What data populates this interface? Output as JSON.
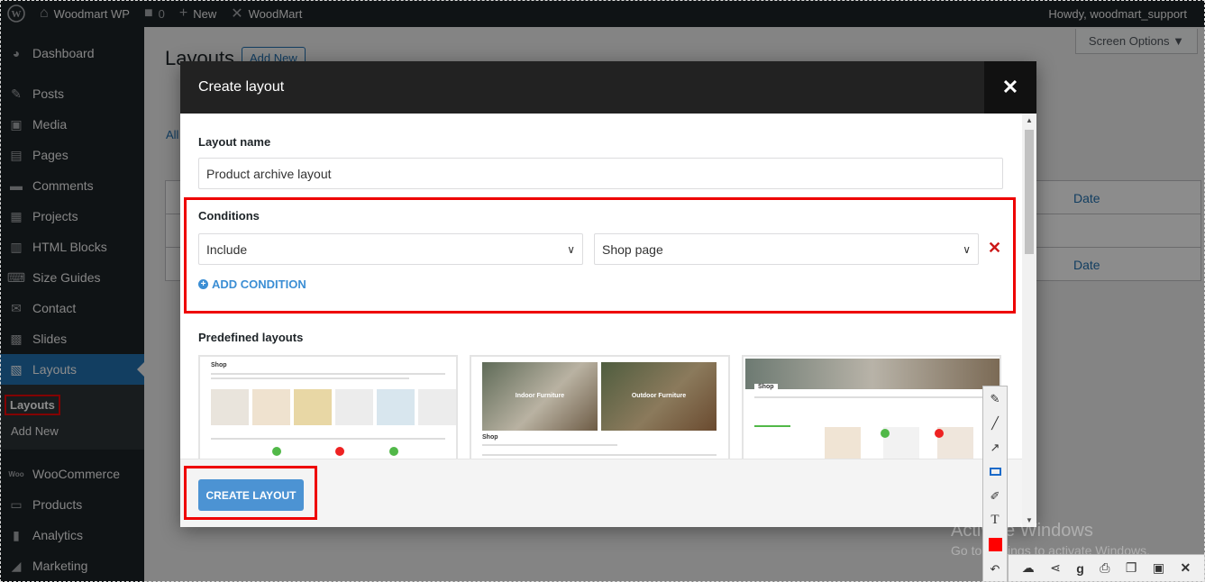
{
  "adminbar": {
    "site_name": "Woodmart WP",
    "comments_count": "0",
    "new_label": "New",
    "theme_label": "WoodMart",
    "howdy": "Howdy, woodmart_support"
  },
  "sidebar": {
    "items": [
      {
        "label": "Dashboard",
        "icon": "dashboard-icon"
      },
      {
        "label": "Posts",
        "icon": "pin-icon"
      },
      {
        "label": "Media",
        "icon": "media-icon"
      },
      {
        "label": "Pages",
        "icon": "pages-icon"
      },
      {
        "label": "Comments",
        "icon": "comment-icon"
      },
      {
        "label": "Projects",
        "icon": "portfolio-icon"
      },
      {
        "label": "HTML Blocks",
        "icon": "blocks-icon"
      },
      {
        "label": "Size Guides",
        "icon": "keyboard-icon"
      },
      {
        "label": "Contact",
        "icon": "envelope-icon"
      },
      {
        "label": "Slides",
        "icon": "slides-icon"
      },
      {
        "label": "Layouts",
        "icon": "layouts-icon"
      },
      {
        "label": "WooCommerce",
        "icon": "woo-icon"
      },
      {
        "label": "Products",
        "icon": "archive-icon"
      },
      {
        "label": "Analytics",
        "icon": "chart-icon"
      },
      {
        "label": "Marketing",
        "icon": "megaphone-icon"
      }
    ],
    "submenu": {
      "current": "Layouts",
      "add_new": "Add New"
    }
  },
  "background": {
    "page_title": "Layouts",
    "add_new": "Add New",
    "screen_options": "Screen Options ▼",
    "all_link": "All",
    "date_col": "Date"
  },
  "modal": {
    "title": "Create layout",
    "layout_name_label": "Layout name",
    "layout_name_value": "Product archive layout",
    "conditions_label": "Conditions",
    "condition_type": "Include",
    "condition_target": "Shop page",
    "add_condition": "ADD CONDITION",
    "predefined_label": "Predefined layouts",
    "thumb1_title": "Shop",
    "thumb2_label_left": "Indoor Furniture",
    "thumb2_label_right": "Outdoor Furniture",
    "thumb2_title": "Shop",
    "thumb3_title": "Shop",
    "create_button": "CREATE LAYOUT"
  },
  "watermark": {
    "title": "Activate Windows",
    "subtitle": "Go to Settings to activate Windows."
  },
  "colors": {
    "accent": "#2271b1",
    "highlight": "#ee0000",
    "button": "#4c93d3"
  }
}
